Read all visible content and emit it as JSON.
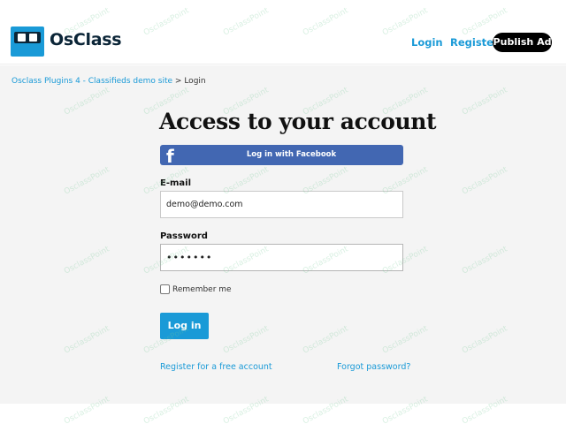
{
  "header": {
    "logo_text": "OsClass",
    "nav_login": "Login",
    "nav_register": "Register",
    "publish_ad": "Publish Ad"
  },
  "breadcrumb": {
    "home": "Osclass Plugins 4 - Classifieds demo site",
    "separator": " > ",
    "current": "Login"
  },
  "form": {
    "title": "Access to your account",
    "facebook_label": "Log in with Facebook",
    "facebook_icon": "f",
    "email_label": "E-mail",
    "email_value": "demo@demo.com",
    "password_label": "Password",
    "password_value": "•••••••",
    "remember_label": "Remember me",
    "remember_checked": false,
    "submit_label": "Log in",
    "register_link": "Register for a free account",
    "forgot_link": "Forgot password?"
  },
  "watermark_text": "OsclassPoint",
  "colors": {
    "accent": "#1a9ad7",
    "facebook": "#4267b2",
    "logo_dark": "#0b2537",
    "page_bg": "#f4f4f4"
  }
}
